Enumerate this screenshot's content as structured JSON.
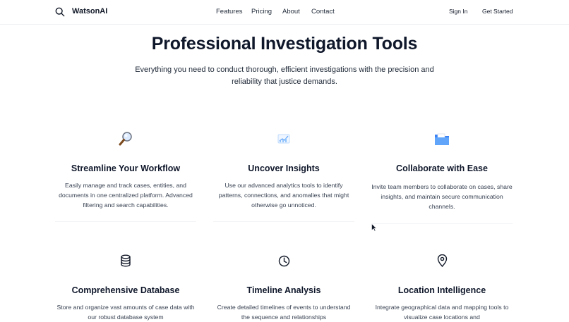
{
  "nav": {
    "brand": "WatsonAI",
    "links": [
      "Features",
      "Pricing",
      "About",
      "Contact"
    ],
    "sign_in": "Sign In",
    "get_started": "Get Started"
  },
  "hero": {
    "title": "Professional Investigation Tools",
    "subtitle": "Everything you need to conduct thorough, efficient investigations with the precision and reliability that justice demands."
  },
  "features": [
    {
      "icon": "magnifying-glass-icon",
      "title": "Streamline Your Workflow",
      "desc": "Easily manage and track cases, entities, and documents in one centralized platform. Advanced filtering and search capabilities."
    },
    {
      "icon": "chart-icon",
      "title": "Uncover Insights",
      "desc": "Use our advanced analytics tools to identify patterns, connections, and anomalies that might otherwise go unnoticed."
    },
    {
      "icon": "folder-icon",
      "title": "Collaborate with Ease",
      "desc": "Invite team members to collaborate on cases, share insights, and maintain secure communication channels."
    },
    {
      "icon": "database-icon",
      "title": "Comprehensive Database",
      "desc": "Store and organize vast amounts of case data with our robust database system"
    },
    {
      "icon": "clock-icon",
      "title": "Timeline Analysis",
      "desc": "Create detailed timelines of events to understand the sequence and relationships"
    },
    {
      "icon": "map-pin-icon",
      "title": "Location Intelligence",
      "desc": "Integrate geographical data and mapping tools to visualize case locations and"
    }
  ]
}
